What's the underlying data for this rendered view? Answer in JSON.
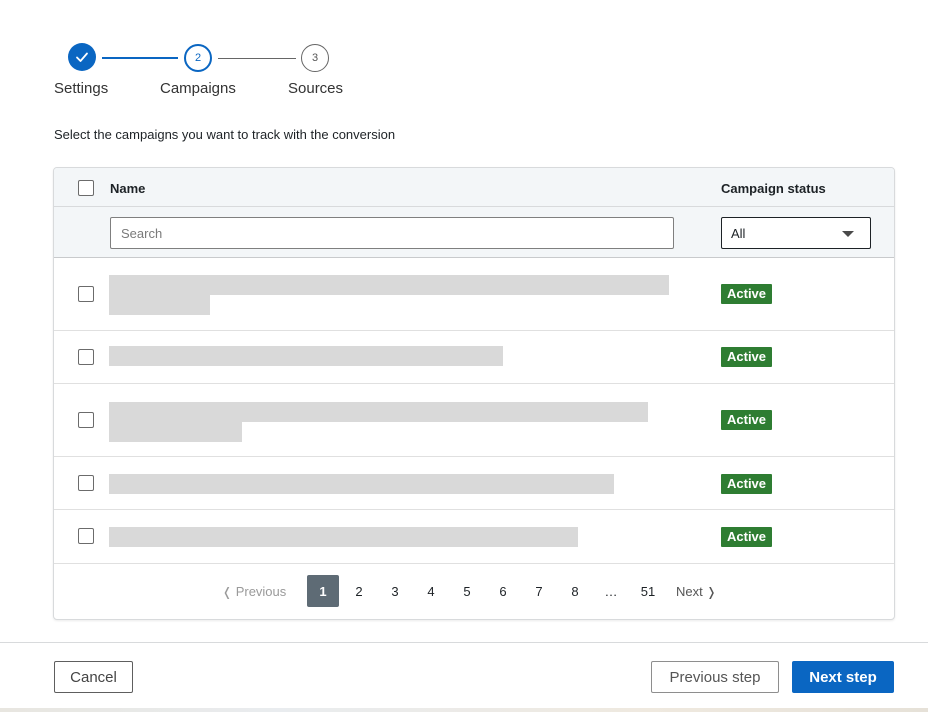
{
  "stepper": {
    "steps": [
      {
        "label": "Settings",
        "number": "",
        "state": "done"
      },
      {
        "label": "Campaigns",
        "number": "2",
        "state": "current"
      },
      {
        "label": "Sources",
        "number": "3",
        "state": "todo"
      }
    ]
  },
  "instruction": "Select the campaigns you want to track with the conversion",
  "table": {
    "columns": {
      "name": "Name",
      "status": "Campaign status"
    },
    "search": {
      "placeholder": "Search",
      "value": ""
    },
    "status_filter": {
      "selected": "All"
    },
    "rows": [
      {
        "name": "",
        "status": "Active"
      },
      {
        "name": "",
        "status": "Active"
      },
      {
        "name": "",
        "status": "Active"
      },
      {
        "name": "",
        "status": "Active"
      },
      {
        "name": "",
        "status": "Active"
      }
    ]
  },
  "pagination": {
    "previous": "Previous",
    "next": "Next",
    "pages": [
      "1",
      "2",
      "3",
      "4",
      "5",
      "6",
      "7",
      "8",
      "…",
      "51"
    ],
    "current": "1"
  },
  "footer": {
    "cancel": "Cancel",
    "previous_step": "Previous step",
    "next_step": "Next step"
  },
  "colors": {
    "accent": "#0a66c2",
    "active_badge": "#2e7d32",
    "current_page": "#5e6b75"
  }
}
